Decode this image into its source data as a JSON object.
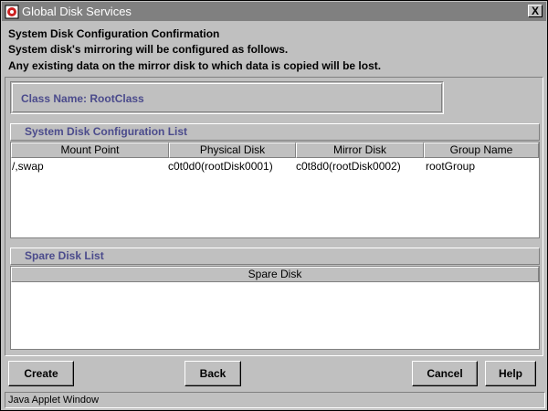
{
  "window": {
    "title": "Global Disk Services",
    "close_label": "X"
  },
  "messages": {
    "heading": "System Disk Configuration Confirmation",
    "line1": "System disk's mirroring will be configured as follows.",
    "line2": "Any existing data on the mirror disk to which data is copied will be lost."
  },
  "class_name": "Class Name: RootClass",
  "config_list": {
    "title": "System Disk Configuration List",
    "columns": [
      "Mount Point",
      "Physical Disk",
      "Mirror Disk",
      "Group Name"
    ],
    "rows": [
      [
        "/,swap",
        "c0t0d0(rootDisk0001)",
        "c0t8d0(rootDisk0002)",
        "rootGroup"
      ]
    ]
  },
  "spare_list": {
    "title": "Spare Disk List",
    "columns": [
      "Spare Disk"
    ]
  },
  "buttons": {
    "create": "Create",
    "back": "Back",
    "cancel": "Cancel",
    "help": "Help"
  },
  "status": "Java Applet Window",
  "colors": {
    "titlebar": "#808080",
    "section_text": "#4b4b8c",
    "background": "#c0c0c0"
  }
}
